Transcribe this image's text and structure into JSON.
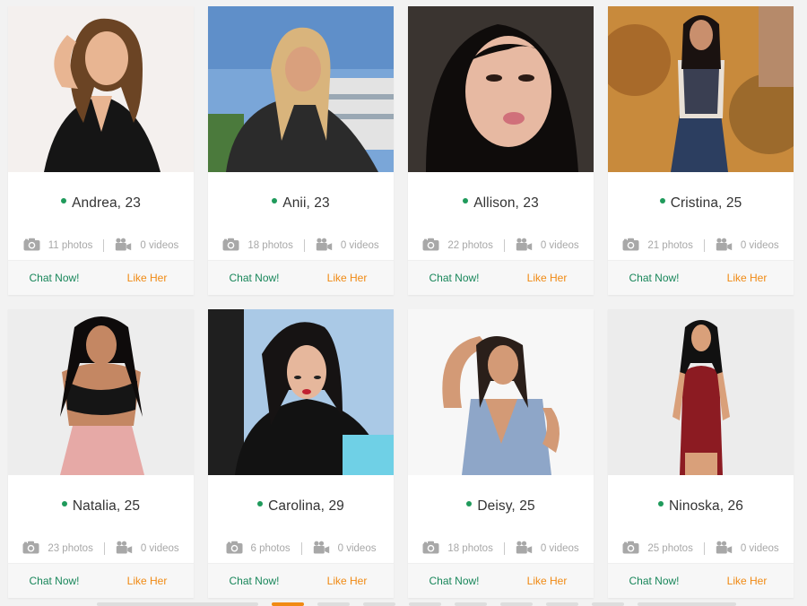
{
  "profiles": [
    {
      "name": "Andrea, 23",
      "photos": "11 photos",
      "videos": "0 videos",
      "chat": "Chat Now!",
      "like": "Like Her",
      "bg": "#f4f0ee",
      "hair": "#6b4424",
      "outfit": "#151515",
      "skin": "#e8b592"
    },
    {
      "name": "Anii, 23",
      "photos": "18 photos",
      "videos": "0 videos",
      "chat": "Chat Now!",
      "like": "Like Her",
      "bg": "#7aa6d8",
      "hair": "#d9b47c",
      "outfit": "#2b2b2b",
      "skin": "#d9a07d"
    },
    {
      "name": "Allison, 23",
      "photos": "22 photos",
      "videos": "0 videos",
      "chat": "Chat Now!",
      "like": "Like Her",
      "bg": "#3a3430",
      "hair": "#0f0c0b",
      "outfit": "#1a1a1a",
      "skin": "#e7b9a2"
    },
    {
      "name": "Cristina, 25",
      "photos": "21 photos",
      "videos": "0 videos",
      "chat": "Chat Now!",
      "like": "Like Her",
      "bg": "#c88a3c",
      "hair": "#1a1210",
      "outfit": "#2c3e60",
      "skin": "#c98f6d"
    },
    {
      "name": "Natalia, 25",
      "photos": "23 photos",
      "videos": "0 videos",
      "chat": "Chat Now!",
      "like": "Like Her",
      "bg": "#ededed",
      "hair": "#0e0b0b",
      "outfit": "#e6a9a6",
      "skin": "#c48763"
    },
    {
      "name": "Carolina, 29",
      "photos": "6 photos",
      "videos": "0 videos",
      "chat": "Chat Now!",
      "like": "Like Her",
      "bg": "#aac9e6",
      "hair": "#161313",
      "outfit": "#121212",
      "skin": "#e6b79c"
    },
    {
      "name": "Deisy, 25",
      "photos": "18 photos",
      "videos": "0 videos",
      "chat": "Chat Now!",
      "like": "Like Her",
      "bg": "#f7f7f7",
      "hair": "#2a1f1a",
      "outfit": "#8ea6c8",
      "skin": "#d39a76"
    },
    {
      "name": "Ninoska, 26",
      "photos": "25 photos",
      "videos": "0 videos",
      "chat": "Chat Now!",
      "like": "Like Her",
      "bg": "#ececec",
      "hair": "#111111",
      "outfit": "#8c1b22",
      "skin": "#d9a07a"
    }
  ],
  "colors": {
    "online": "#1f9a5b",
    "chat": "#18865a",
    "like": "#f08a14",
    "muted": "#a8a8a8"
  },
  "icons": {
    "photos": "camera-icon",
    "videos": "video-camera-icon"
  }
}
